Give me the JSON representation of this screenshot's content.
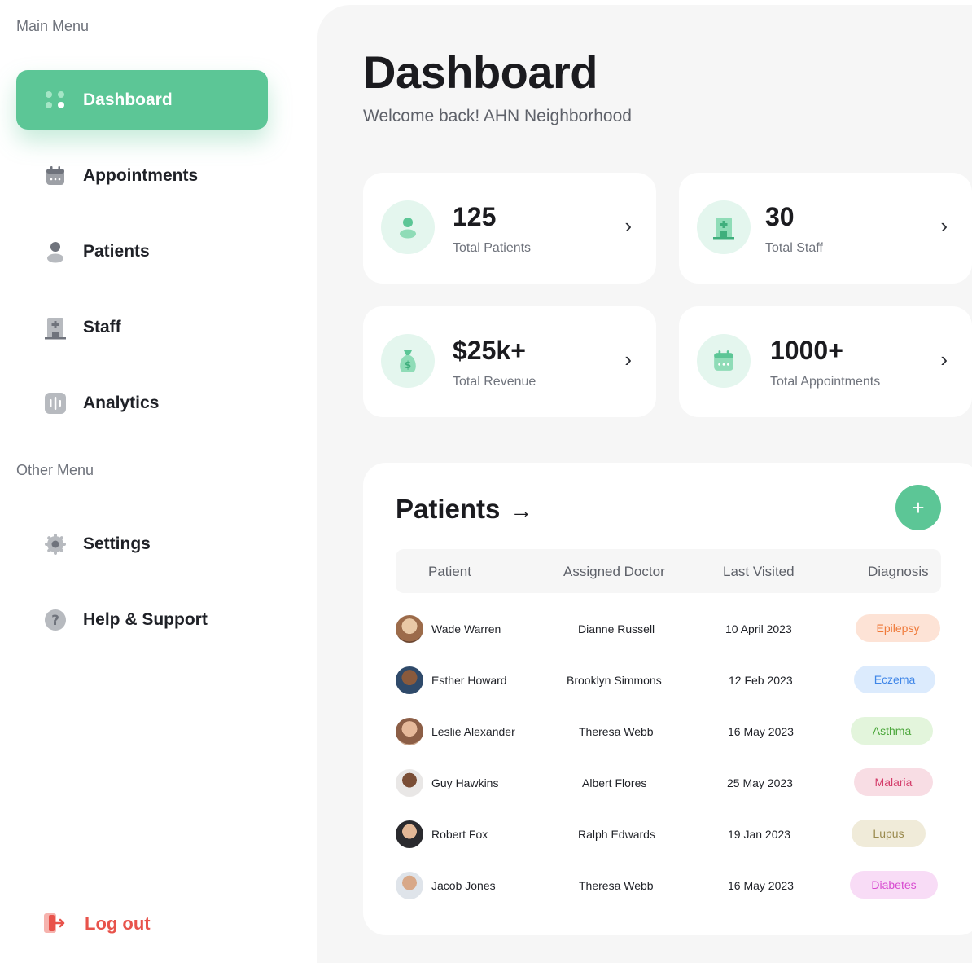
{
  "sidebar": {
    "main_menu_heading": "Main Menu",
    "other_menu_heading": "Other Menu",
    "items": [
      {
        "label": "Dashboard",
        "icon": "grid-icon"
      },
      {
        "label": "Appointments",
        "icon": "calendar-icon"
      },
      {
        "label": "Patients",
        "icon": "user-icon"
      },
      {
        "label": "Staff",
        "icon": "building-icon"
      },
      {
        "label": "Analytics",
        "icon": "chart-icon"
      }
    ],
    "other_items": [
      {
        "label": "Settings",
        "icon": "gear-icon"
      },
      {
        "label": "Help & Support",
        "icon": "question-icon"
      }
    ],
    "logout_label": "Log out"
  },
  "header": {
    "title": "Dashboard",
    "subtitle": "Welcome back! AHN Neighborhood"
  },
  "stats": [
    {
      "value": "125",
      "label": "Total Patients",
      "icon": "user-icon"
    },
    {
      "value": "30",
      "label": "Total Staff",
      "icon": "building-icon"
    },
    {
      "value": "$25k+",
      "label": "Total Revenue",
      "icon": "money-bag-icon"
    },
    {
      "value": "1000+",
      "label": "Total Appointments",
      "icon": "calendar-icon"
    }
  ],
  "patients_table": {
    "title": "Patients",
    "arrow": "→",
    "add_label": "+",
    "columns": [
      "Patient",
      "Assigned Doctor",
      "Last Visited",
      "Diagnosis"
    ],
    "rows": [
      {
        "patient": "Wade Warren",
        "doctor": "Dianne Russell",
        "last_visited": "10 April 2023",
        "diagnosis": "Epilepsy"
      },
      {
        "patient": "Esther Howard",
        "doctor": "Brooklyn Simmons",
        "last_visited": "12 Feb 2023",
        "diagnosis": "Eczema"
      },
      {
        "patient": "Leslie Alexander",
        "doctor": "Theresa Webb",
        "last_visited": "16 May 2023",
        "diagnosis": "Asthma"
      },
      {
        "patient": "Guy Hawkins",
        "doctor": "Albert Flores",
        "last_visited": "25 May 2023",
        "diagnosis": "Malaria"
      },
      {
        "patient": "Robert Fox",
        "doctor": "Ralph Edwards",
        "last_visited": "19 Jan 2023",
        "diagnosis": "Lupus"
      },
      {
        "patient": "Jacob Jones",
        "doctor": "Theresa Webb",
        "last_visited": "16 May 2023",
        "diagnosis": "Diabetes"
      }
    ]
  },
  "colors": {
    "accent": "#5cc696",
    "logout": "#e8534b",
    "epilepsy_bg": "#fde3d6",
    "epilepsy_fg": "#ef7a3a",
    "eczema_bg": "#dcebfd",
    "eczema_fg": "#3f86e8",
    "asthma_bg": "#e3f5dc",
    "asthma_fg": "#4aa63a",
    "malaria_bg": "#f8dde4",
    "malaria_fg": "#d43c6a",
    "lupus_bg": "#f0ebd9",
    "lupus_fg": "#9a8a4e",
    "diabetes_bg": "#f8dcf6",
    "diabetes_fg": "#d84bd0"
  }
}
